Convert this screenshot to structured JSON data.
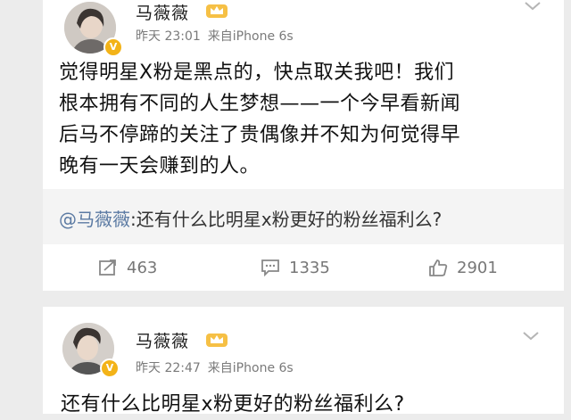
{
  "posts": [
    {
      "username": "马薇薇",
      "time": "昨天 23:01",
      "source": "来自iPhone 6s",
      "content": "觉得明星X粉是黑点的，快点取关我吧！我们\n根本拥有不同的人生梦想——一个今早看新闻\n后马不停蹄的关注了贵偶像并不知为何觉得早\n晚有一天会赚到的人。",
      "repost_mention": "@马薇薇",
      "repost_text": ":还有什么比明星x粉更好的粉丝福利么?",
      "repost_count": "463",
      "comment_count": "1335",
      "like_count": "2901"
    },
    {
      "username": "马薇薇",
      "time": "昨天 22:47",
      "source": "来自iPhone 6s",
      "content": "还有什么比明星x粉更好的粉丝福利么?"
    }
  ],
  "colors": {
    "mention": "#5b7aa3",
    "meta": "#7a7a7a",
    "vip_badge": "#f3b318",
    "background": "#ececec"
  },
  "icons": {
    "verified": "verified-v-badge",
    "member": "crown-icon",
    "repost": "repost-icon",
    "comment": "comment-icon",
    "like": "thumbs-up-icon",
    "menu": "chevron-down-icon"
  }
}
